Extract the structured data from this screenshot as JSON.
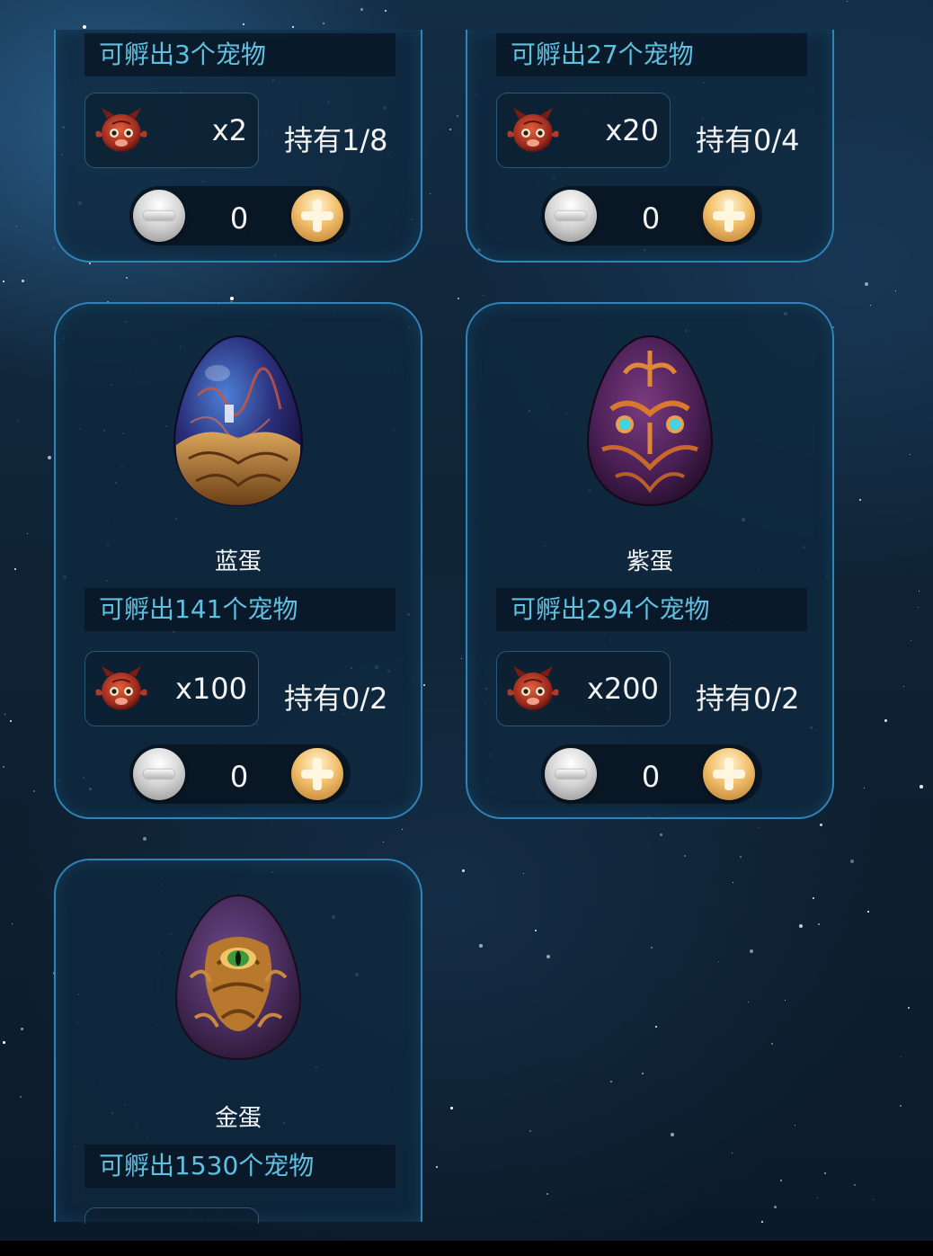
{
  "colors": {
    "card_border": "#2f84b8",
    "hatch_text": "#5fc0e0",
    "white_text": "#f4f4f4"
  },
  "cards": [
    {
      "hatch_text": "可孵出3个宠物",
      "cost_icon": "devil-face-icon",
      "cost_qty": "x2",
      "owned": "持有1/8",
      "quantity": "0"
    },
    {
      "hatch_text": "可孵出27个宠物",
      "cost_icon": "devil-face-icon",
      "cost_qty": "x20",
      "owned": "持有0/4",
      "quantity": "0"
    },
    {
      "name": "蓝蛋",
      "egg_image": "blue-egg-icon",
      "hatch_text": "可孵出141个宠物",
      "cost_icon": "devil-face-icon",
      "cost_qty": "x100",
      "owned": "持有0/2",
      "quantity": "0"
    },
    {
      "name": "紫蛋",
      "egg_image": "purple-egg-icon",
      "hatch_text": "可孵出294个宠物",
      "cost_icon": "devil-face-icon",
      "cost_qty": "x200",
      "owned": "持有0/2",
      "quantity": "0"
    },
    {
      "name": "金蛋",
      "egg_image": "gold-egg-icon",
      "hatch_text": "可孵出1530个宠物"
    }
  ]
}
